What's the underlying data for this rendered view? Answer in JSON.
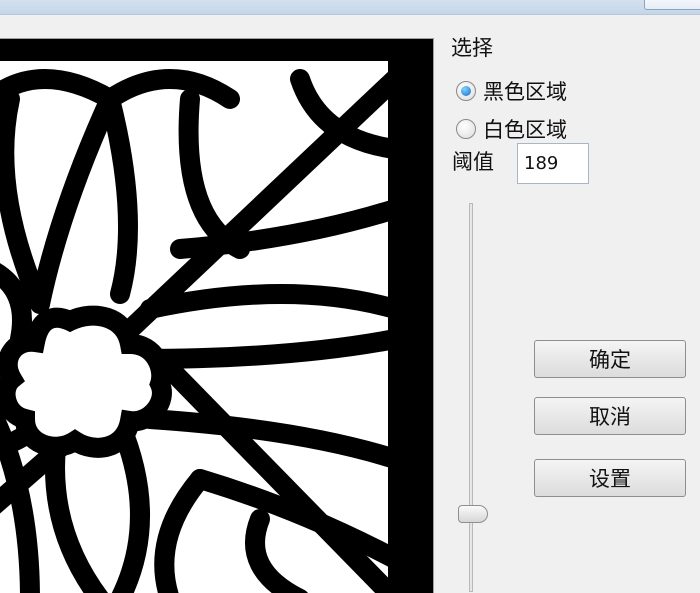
{
  "panel": {
    "section_label": "选择",
    "options": [
      {
        "label": "黑色区域",
        "selected": true
      },
      {
        "label": "白色区域",
        "selected": false
      }
    ],
    "threshold_label": "阈值",
    "threshold_value": "189"
  },
  "buttons": {
    "ok_label": "确定",
    "cancel_label": "取消",
    "settings_label": "设置"
  },
  "slider": {
    "position_fraction": 0.8
  }
}
